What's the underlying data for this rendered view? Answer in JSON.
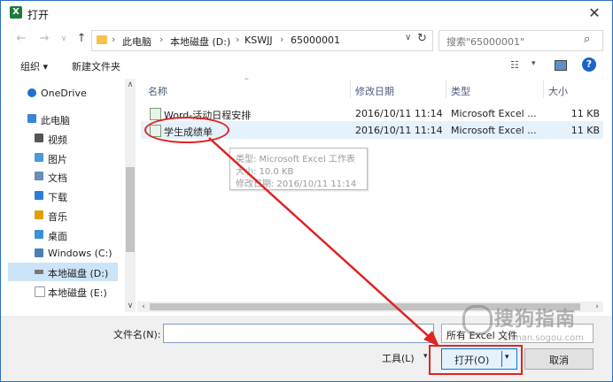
{
  "window": {
    "title": "打开",
    "app_icon": "excel-icon",
    "close_glyph": "✕"
  },
  "address_bar": {
    "segments": [
      "此电脑",
      "本地磁盘 (D:)",
      "KSWJJ",
      "65000001"
    ],
    "search_placeholder": "搜索\"65000001\""
  },
  "toolbar": {
    "organize_label": "组织 ▾",
    "new_folder_label": "新建文件夹"
  },
  "nav": {
    "items": [
      {
        "label": "OneDrive",
        "icon": "cloud-icon",
        "color": "#1c6fd1"
      },
      {
        "label": "此电脑",
        "icon": "computer-icon",
        "color": "#3b84d6"
      },
      {
        "label": "视频",
        "icon": "video-folder-icon",
        "color": "#555555"
      },
      {
        "label": "图片",
        "icon": "picture-folder-icon",
        "color": "#4a9ad8"
      },
      {
        "label": "文档",
        "icon": "document-folder-icon",
        "color": "#6a8db5"
      },
      {
        "label": "下载",
        "icon": "download-folder-icon",
        "color": "#2a7fd4"
      },
      {
        "label": "音乐",
        "icon": "music-folder-icon",
        "color": "#e0a000"
      },
      {
        "label": "桌面",
        "icon": "desktop-folder-icon",
        "color": "#3a8fd8"
      },
      {
        "label": "Windows (C:)",
        "icon": "drive-c-icon",
        "color": "#4a7fb5"
      },
      {
        "label": "本地磁盘 (D:)",
        "icon": "drive-d-icon",
        "color": "#777777"
      },
      {
        "label": "本地磁盘 (E:)",
        "icon": "drive-e-icon",
        "color": "#999999"
      }
    ],
    "selected_index": 9
  },
  "columns": {
    "name": "名称",
    "modified": "修改日期",
    "type": "类型",
    "size": "大小"
  },
  "files": [
    {
      "name": "Word-活动日程安排",
      "modified": "2016/10/11 11:14",
      "type": "Microsoft Excel ...",
      "size": "11 KB"
    },
    {
      "name": "学生成绩单",
      "modified": "2016/10/11 11:14",
      "type": "Microsoft Excel ...",
      "size": "11 KB"
    }
  ],
  "tooltip": {
    "line1": "类型: Microsoft Excel 工作表",
    "line2": "大小: 10.0 KB",
    "line3": "修改日期: 2016/10/11 11:14"
  },
  "footer": {
    "filename_label": "文件名(N):",
    "filename_value": "",
    "filter_value": "所有 Excel 文件",
    "tools_label": "工具(L)",
    "open_label": "打开(O)",
    "cancel_label": "取消"
  },
  "watermark": {
    "brand": "搜狗指南",
    "url": "zhinan.sogou.com"
  },
  "annotation_color": "#e02323"
}
